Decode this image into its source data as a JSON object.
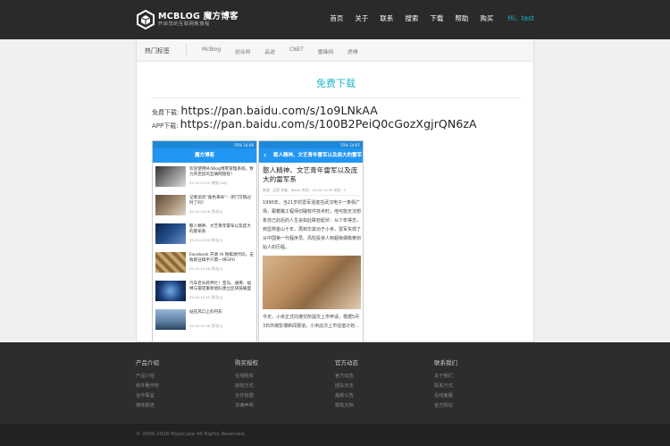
{
  "header": {
    "logo_title": "MCBLOG 魔方博客",
    "logo_sub": "开启您的互联网新旅程",
    "nav": [
      "首页",
      "关于",
      "联系",
      "搜索",
      "下载",
      "帮助",
      "购买"
    ],
    "user": "Hi，test"
  },
  "tags": {
    "title": "热门标签",
    "items": [
      "McBlog",
      "创业邦",
      "品途",
      "CNET",
      "雷锋网",
      "虎嗅"
    ]
  },
  "download": {
    "title": "免费下载",
    "pc_label": "免费下载:",
    "pc_url": "https://pan.baidu.com/s/1o9LNkAA",
    "app_label": "APP下载:",
    "app_url": "https://pan.baidu.com/s/100B2PeiQ0cGozXgjrQN6zA"
  },
  "phone1": {
    "status": "55% 14:06",
    "title": "魔方博客",
    "items": [
      {
        "title": "欢迎使用McBlog博客管理系统，致力开启您的互联网旅程！",
        "date": "01-20 23:22 系统[218]"
      },
      {
        "title": "记者追问“角色革命”：闭门写稿过时了吗？",
        "date": "05-04 14:06 资讯[5]"
      },
      {
        "title": "憨人精神、文艺青年雷军以及庞大的雷军系",
        "date": "05-04 13:56 资讯[2]"
      },
      {
        "title": "Facebook 开源 AI 围棋源代码，击败职业棋手只需一块GPU",
        "date": "05-04 13:46 资讯[2]"
      },
      {
        "title": "汽车巨头跨界忙！宝马、通用、福特与雷诺重新组队建立区块链联盟",
        "date": "05-04 13:43 资讯[2]"
      },
      {
        "title": "站在风口上的丹东",
        "date": "05-04 13:36 资讯[2]"
      }
    ]
  },
  "phone2": {
    "status": "55% 14:07",
    "title": "憨人精神、文艺青年雷军以及庞大的雷军系",
    "article_title": "憨人精神、文艺青年雷军以及庞大的雷军系",
    "meta": "来源：品途  作者：Robot  时间：05-04 13:56  浏览：2",
    "para1": "1990年，当21岁的雷军混迹在武汉电子一条街广场，跟着路工程师切磋软件技术时，他可能无法想象自己此后的人生会如此跌宕起伏：从少年得志，到坚熬金山十年，再到华其功于小米，雷军实现了从中国第一代程序员、风险投资人到超级偶像黄剑始人的历程。",
    "para2": "今天，小米正式向港交所提交上市申请，根据5月3日外媒彭博新闻报道，小米此次上市估值计划..."
  },
  "footer": {
    "columns": [
      {
        "title": "产品介绍",
        "items": [
          "产品介绍",
          "软件著作权",
          "合作事宜",
          "媒体报道"
        ]
      },
      {
        "title": "购买授权",
        "items": [
          "在线购买",
          "授权方式",
          "合作加盟",
          "法律声明"
        ]
      },
      {
        "title": "官方动态",
        "items": [
          "官方动态",
          "团队日志",
          "最新公告",
          "帮助文档"
        ]
      },
      {
        "title": "联系我们",
        "items": [
          "关于我们",
          "联系方式",
          "在线客服",
          "官方网站"
        ]
      }
    ],
    "copyright": "© 2000-2018 MojoCube All Rights Reserved."
  },
  "colors": {
    "accent": "#27b7c9",
    "app_bar": "#2196f3",
    "header_bg": "#2a2a2a",
    "footer_bg": "#2d2d2d"
  }
}
